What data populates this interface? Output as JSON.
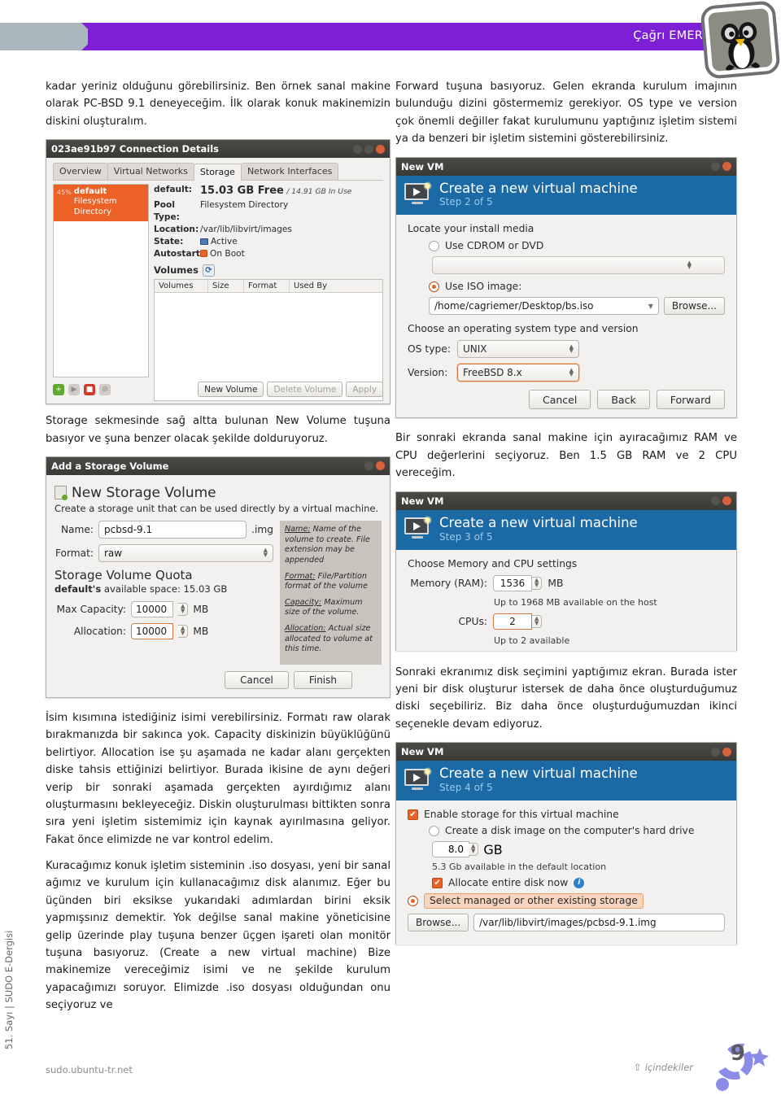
{
  "header": {
    "author": "Çağrı EMER",
    "logo_name": "penguin-logo"
  },
  "left_column": {
    "intro_paragraph": "kadar yeriniz olduğunu görebilirsiniz. Ben örnek sanal makine olarak PC-BSD 9.1 deneyeceğim. İlk olarak konuk makinemizin diskini oluşturalım.",
    "storage_paragraph": "Storage sekmesinde sağ altta bulunan New Volume tuşuna basıyor ve şuna benzer olacak şekilde dolduruyoruz.",
    "name_paragraph": "İsim kısımına istediğiniz isimi verebilirsiniz. Formatı raw olarak bırakmanızda bir sakınca yok. Capacity diskinizin büyüklüğünü belirtiyor. Allocation ise şu aşamada ne kadar alanı gerçekten diske tahsis ettiğinizi belirtiyor. Burada ikisine de aynı değeri verip bir sonraki aşamada gerçekten ayırdığımız alanı oluşturmasını bekleyeceğiz. Diskin oluşturulması bittikten sonra sıra yeni işletim sistemimiz için kaynak ayırılmasına geliyor. Fakat önce elimizde ne var kontrol edelim.",
    "iso_paragraph": "Kuracağımız konuk işletim sisteminin .iso dosyası, yeni bir sanal ağımız ve kurulum için kullanacağımız disk alanımız. Eğer bu üçünden biri eksikse yukarıdaki adımlardan birini eksik yapmışsınız demektir. Yok değilse sanal makine yöneticisine gelip üzerinde play tuşuna benzer üçgen işareti olan monitör tuşuna basıyoruz. (Create a new virtual machine) Bize makinemize vereceğimiz isimi ve ne şekilde kurulum yapacağımızı soruyor. Elimizde .iso dosyası olduğundan onu seçiyoruz ve"
  },
  "right_column": {
    "forward_paragraph": "Forward tuşuna basıyoruz. Gelen ekranda kurulum imajının bulunduğu dizini göstermemiz gerekiyor. OS type ve version çok önemli değiller fakat kurulumunu yaptığınız işletim sistemi ya da benzeri bir işletim sistemini gösterebilirsiniz.",
    "ram_paragraph": "Bir sonraki ekranda sanal makine için ayıracağımız RAM ve CPU değerlerini seçiyoruz. Ben 1.5 GB RAM ve 2 CPU vereceğim.",
    "disk_paragraph": "Sonraki ekranımız disk seçimini yaptığımız ekran. Burada ister yeni bir disk oluşturur istersek de daha önce oluşturduğumuz diski seçebiliriz. Biz daha önce oluşturduğumuzdan ikinci seçenekle devam ediyoruz."
  },
  "connection_details": {
    "title": "023ae91b97 Connection Details",
    "tabs": [
      {
        "label": "Overview",
        "active": false
      },
      {
        "label": "Virtual Networks",
        "active": false
      },
      {
        "label": "Storage",
        "active": true
      },
      {
        "label": "Network Interfaces",
        "active": false
      }
    ],
    "pool_percent": "45%",
    "pool_name": "default",
    "pool_kind": "Filesystem Directory",
    "rows": [
      {
        "label": "default:",
        "value": "15.03 GB Free",
        "extra": "/ 14.91 GB In Use"
      },
      {
        "label": "Pool Type:",
        "value": "Filesystem Directory",
        "extra": ""
      },
      {
        "label": "Location:",
        "value": "/var/lib/libvirt/images",
        "extra": ""
      },
      {
        "label": "State:",
        "value": "Active",
        "extra": ""
      },
      {
        "label": "Autostart:",
        "value": "On Boot",
        "extra": ""
      }
    ],
    "volumes_header": "Volumes",
    "columns": [
      "Volumes",
      "Size",
      "Format",
      "Used By"
    ],
    "buttons": {
      "new_volume": "New Volume",
      "delete_volume": "Delete Volume",
      "apply": "Apply"
    }
  },
  "storage_volume": {
    "title": "Add a Storage Volume",
    "heading": "New Storage Volume",
    "subtitle": "Create a storage unit that can be used directly by a virtual machine.",
    "name_label": "Name:",
    "name_value": "pcbsd-9.1",
    "name_extension": ".img",
    "format_label": "Format:",
    "format_value": "raw",
    "quota_heading": "Storage Volume Quota",
    "available_bold": "default's",
    "available_rest": " available space: 15.03 GB",
    "max_capacity_label": "Max Capacity:",
    "max_capacity_value": "10000",
    "max_capacity_unit": "MB",
    "allocation_label": "Allocation:",
    "allocation_value": "10000",
    "allocation_unit": "MB",
    "help": [
      {
        "term": "Name:",
        "text": " Name of the volume to create. File extension may be appended"
      },
      {
        "term": "Format:",
        "text": " File/Partition format of the volume"
      },
      {
        "term": "Capacity:",
        "text": " Maximum size of the volume."
      },
      {
        "term": "Allocation:",
        "text": " Actual size allocated to volume at this time."
      }
    ],
    "cancel": "Cancel",
    "finish": "Finish"
  },
  "new_vm_step2": {
    "window_title": "New VM",
    "banner_title": "Create a new virtual machine",
    "banner_step": "Step 2 of 5",
    "media_section": "Locate your install media",
    "cdrom_option": "Use CDROM or DVD",
    "iso_option": "Use ISO image:",
    "iso_path": "/home/cagriemer/Desktop/bs.iso",
    "browse": "Browse...",
    "os_section": "Choose an operating system type and version",
    "os_type_label": "OS type:",
    "os_type_value": "UNIX",
    "version_label": "Version:",
    "version_value": "FreeBSD 8.x",
    "cancel": "Cancel",
    "back": "Back",
    "forward": "Forward"
  },
  "new_vm_step3": {
    "window_title": "New VM",
    "banner_title": "Create a new virtual machine",
    "banner_step": "Step 3 of 5",
    "section": "Choose Memory and CPU settings",
    "memory_label": "Memory (RAM):",
    "memory_value": "1536",
    "memory_unit": "MB",
    "memory_hint": "Up to 1968 MB available on the host",
    "cpu_label": "CPUs:",
    "cpu_value": "2",
    "cpu_hint": "Up to 2 available"
  },
  "new_vm_step4": {
    "window_title": "New VM",
    "banner_title": "Create a new virtual machine",
    "banner_step": "Step 4 of 5",
    "enable_storage": "Enable storage for this virtual machine",
    "create_disk": "Create a disk image on the computer's hard drive",
    "disk_size": "8.0",
    "disk_unit": "GB",
    "disk_available": "5.3 Gb available in the default location",
    "allocate_now": "Allocate entire disk now",
    "select_existing": "Select managed or other existing storage",
    "browse": "Browse...",
    "storage_path": "/var/lib/libvirt/images/pcbsd-9.1.img"
  },
  "footer": {
    "sidebar": "51. Sayı | SUDO E-Dergisi",
    "url": "sudo.ubuntu-tr.net",
    "toc": "içindekiler",
    "page_number": "9"
  }
}
